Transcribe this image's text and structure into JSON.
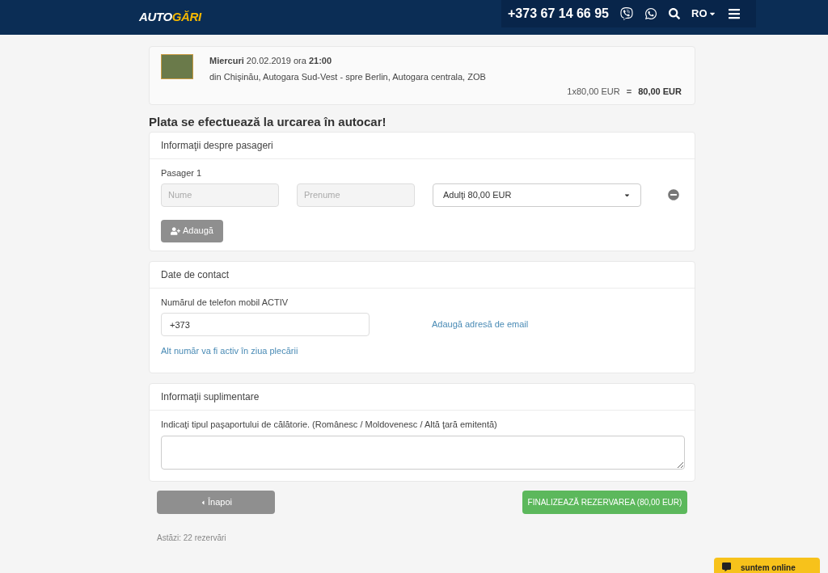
{
  "header": {
    "logo": {
      "part_1": "AUTO",
      "part_2": "GĂRI"
    },
    "phone": "+373 67 14 66 95",
    "language": "RO"
  },
  "trip": {
    "when": "**Miercuri** 20.02.2019 ora **21:00**",
    "route": "din Chişinău, Autogara Sud-Vest - spre Berlin, Autogara centrala, ZOB",
    "price_calc": "1x80,00 EUR",
    "equals": "=",
    "total": "80,00 EUR"
  },
  "notice": "Plata se efectuează la urcarea în autocar!",
  "passengers": {
    "title": "Informaţii despre pasageri",
    "items": [
      {
        "label": "Pasager 1",
        "last_name": {
          "placeholder": "Nume"
        },
        "first_name": {
          "placeholder": "Prenume"
        },
        "fare": "Adulţi 80,00 EUR"
      }
    ],
    "add_button": "Adaugă"
  },
  "contact": {
    "title": "Date de contact",
    "phone_label": "Numărul de telefon mobil ACTIV",
    "phone_value": "+373",
    "email_link": "Adaugă adresă de email",
    "alt_link": "Alt număr va fi activ în ziua plecării"
  },
  "extra": {
    "title": "Informaţii suplimentare",
    "label": "Indicaţi tipul paşaportului de călătorie. (Românesc / Moldovenesc / Altă ţară emitentă)"
  },
  "actions": {
    "back": "Înapoi",
    "finish": "FINALIZEAZĂ REZERVAREA (80,00 EUR)"
  },
  "stats": "Astăzi: 22 rezervări",
  "chat": "suntem online"
}
